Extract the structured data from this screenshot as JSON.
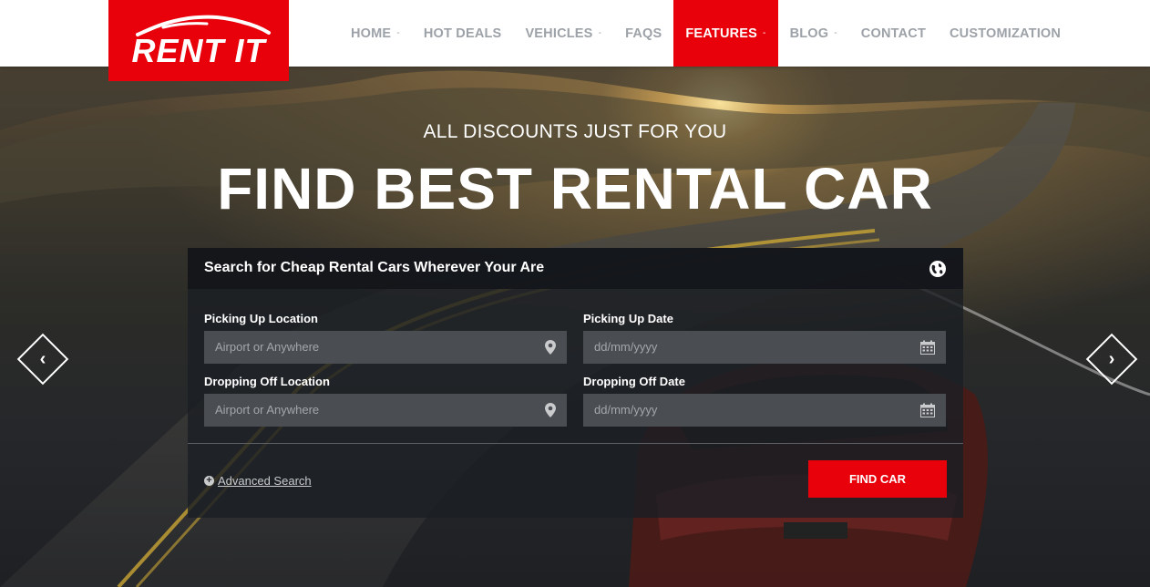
{
  "brand": {
    "name": "RENT IT",
    "color": "#e8000b"
  },
  "nav": {
    "items": [
      {
        "label": "HOME",
        "dropdown": true,
        "active": false
      },
      {
        "label": "HOT DEALS",
        "dropdown": false,
        "active": false
      },
      {
        "label": "VEHICLES",
        "dropdown": true,
        "active": false
      },
      {
        "label": "FAQS",
        "dropdown": false,
        "active": false
      },
      {
        "label": "FEATURES",
        "dropdown": true,
        "active": true
      },
      {
        "label": "BLOG",
        "dropdown": true,
        "active": false
      },
      {
        "label": "CONTACT",
        "dropdown": false,
        "active": false
      },
      {
        "label": "CUSTOMIZATION",
        "dropdown": false,
        "active": false
      }
    ]
  },
  "hero": {
    "subtitle": "ALL DISCOUNTS JUST FOR YOU",
    "title": "FIND BEST RENTAL CAR",
    "prev_icon": "chevron-left-icon",
    "next_icon": "chevron-right-icon"
  },
  "search": {
    "heading": "Search for Cheap Rental Cars Wherever Your Are",
    "heading_icon": "globe-icon",
    "pickup_location": {
      "label": "Picking Up Location",
      "placeholder": "Airport or Anywhere",
      "icon": "map-pin-icon"
    },
    "pickup_date": {
      "label": "Picking Up Date",
      "placeholder": "dd/mm/yyyy",
      "icon": "calendar-icon"
    },
    "dropoff_location": {
      "label": "Dropping Off Location",
      "placeholder": "Airport or Anywhere",
      "icon": "map-pin-icon"
    },
    "dropoff_date": {
      "label": "Dropping Off Date",
      "placeholder": "dd/mm/yyyy",
      "icon": "calendar-icon"
    },
    "advanced_label": "Advanced Search",
    "submit_label": "FIND CAR"
  }
}
